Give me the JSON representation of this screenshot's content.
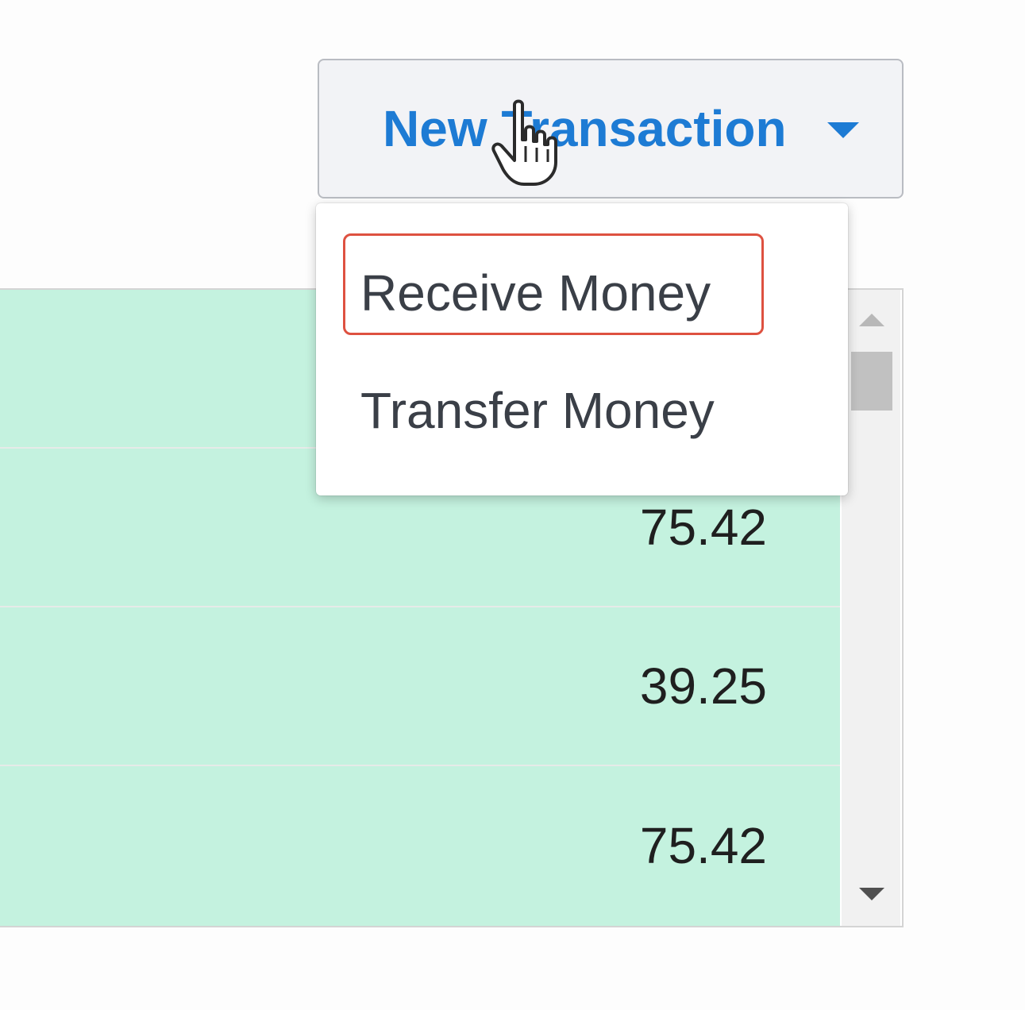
{
  "toolbar": {
    "new_transaction_label": "New Transaction"
  },
  "dropdown": {
    "items": [
      {
        "label": "Receive Money",
        "highlighted": true
      },
      {
        "label": "Transfer Money",
        "highlighted": false
      }
    ]
  },
  "table": {
    "rows": [
      {
        "amount": ""
      },
      {
        "amount": "75.42"
      },
      {
        "amount": "39.25"
      },
      {
        "amount": "75.42"
      }
    ]
  },
  "colors": {
    "accent": "#1d7bd4",
    "row_background": "#c4f2df",
    "highlight_border": "#de5140"
  },
  "icons": {
    "button_caret": "caret-down-icon",
    "cursor": "hand-pointer-icon"
  }
}
